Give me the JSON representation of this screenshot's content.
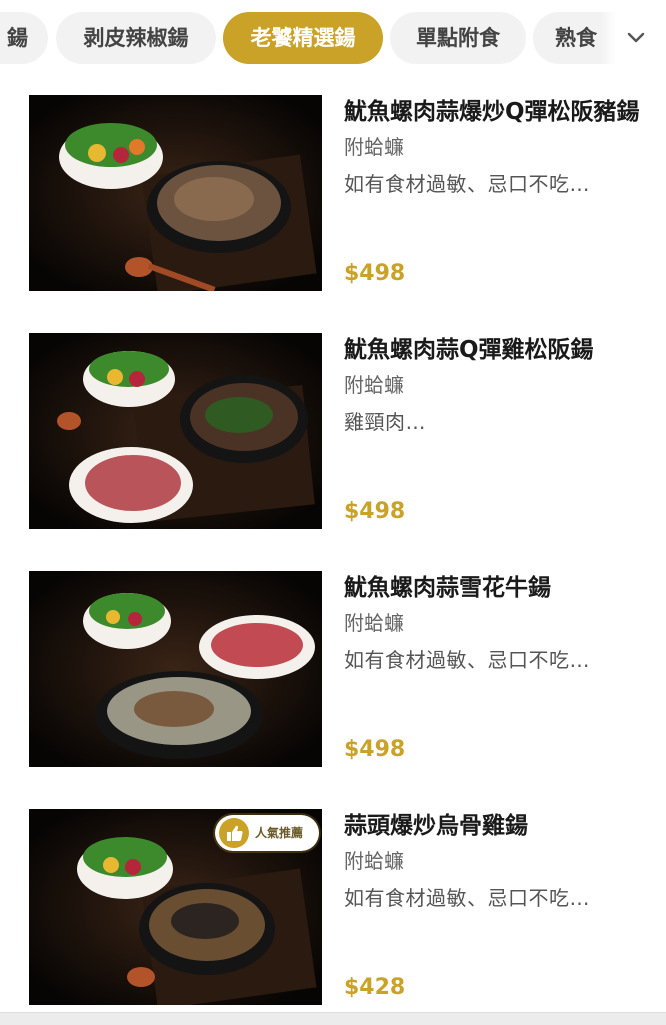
{
  "category_tabs": [
    {
      "label": "鍚"
    },
    {
      "label": "剥皮辣椒鍚"
    },
    {
      "label": "老饕精選鍚"
    },
    {
      "label": "單點附食"
    },
    {
      "label": "熟食"
    }
  ],
  "active_tab_index": 2,
  "expand_icon": "chevron-down-icon",
  "colors": {
    "accent": "#c9a227",
    "title": "#1a1a1a",
    "muted": "#666666",
    "tab_bg": "#f2f2f2"
  },
  "menu_items": [
    {
      "title": "魷魚螺肉蒜爆炒Q彈松阪豬鍚",
      "subtitle": "附蛤蠊",
      "description": "如有食材過敏、忌口不吃…",
      "price": "$498"
    },
    {
      "title": "魷魚螺肉蒜Q彈雞松阪鍚",
      "subtitle": "附蛤蠊",
      "description": "雞頸肉…",
      "price": "$498"
    },
    {
      "title": "魷魚螺肉蒜雪花牛鍚",
      "subtitle": "附蛤蠊",
      "description": " 如有食材過敏、忌口不吃…",
      "price": "$498"
    },
    {
      "title": "蒜頭爆炒烏骨雞鍚",
      "subtitle": "附蛤蠊",
      "description": "如有食材過敏、忌口不吃…",
      "price": "$428",
      "badge": {
        "icon": "thumbs-up-icon",
        "label": "人氣推薦"
      }
    }
  ]
}
